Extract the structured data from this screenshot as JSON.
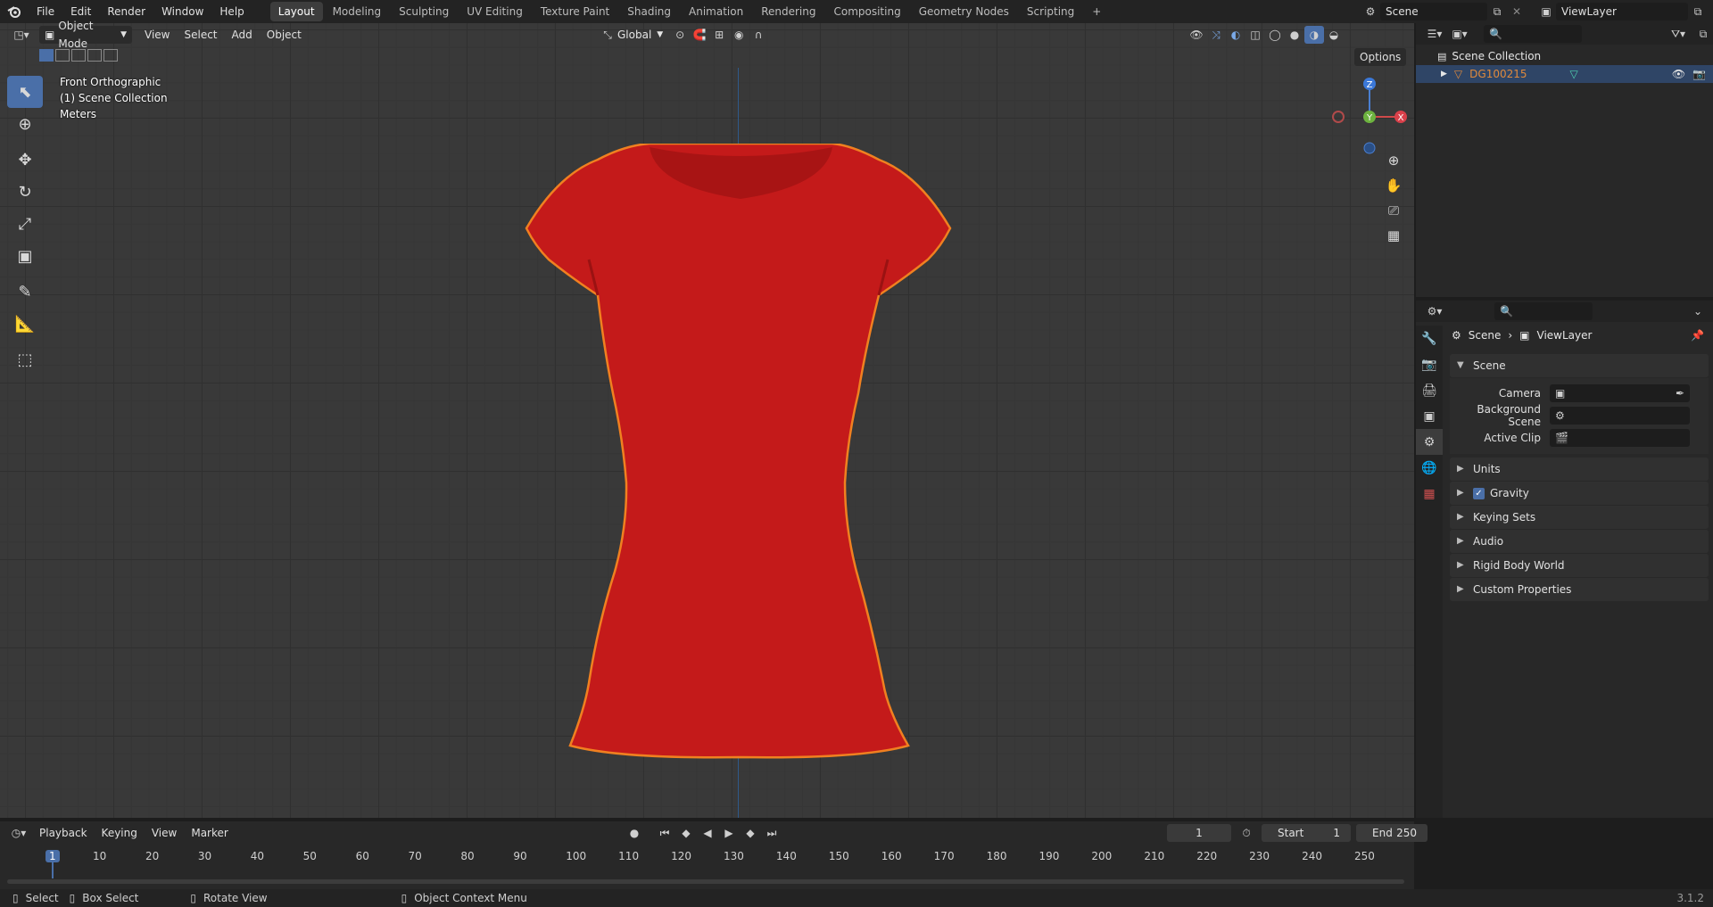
{
  "topbar": {
    "menus": [
      "File",
      "Edit",
      "Render",
      "Window",
      "Help"
    ],
    "workspaces": [
      "Layout",
      "Modeling",
      "Sculpting",
      "UV Editing",
      "Texture Paint",
      "Shading",
      "Animation",
      "Rendering",
      "Compositing",
      "Geometry Nodes",
      "Scripting"
    ],
    "active_workspace": "Layout",
    "add_tab": "+",
    "scene": "Scene",
    "view_layer": "ViewLayer"
  },
  "viewport": {
    "mode": "Object Mode",
    "menus": [
      "View",
      "Select",
      "Add",
      "Object"
    ],
    "transform_orientation": "Global",
    "options_label": "Options",
    "overlay_lines": [
      "Front Orthographic",
      "(1) Scene Collection",
      "Meters"
    ],
    "gizmo": {
      "z": "Z",
      "y": "Y",
      "x": "X"
    },
    "object_color": "#c41a1a",
    "outline_color": "#f08020"
  },
  "outliner": {
    "root": "Scene Collection",
    "object": "DG100215"
  },
  "properties": {
    "breadcrumb_scene": "Scene",
    "breadcrumb_layer": "ViewLayer",
    "panel_title": "Scene",
    "fields": [
      {
        "label": "Camera",
        "value": ""
      },
      {
        "label": "Background Scene",
        "value": ""
      },
      {
        "label": "Active Clip",
        "value": ""
      }
    ],
    "subpanels": [
      "Units",
      "Gravity",
      "Keying Sets",
      "Audio",
      "Rigid Body World",
      "Custom Properties"
    ],
    "gravity_checked": true
  },
  "timeline": {
    "menus": [
      "Playback",
      "Keying",
      "View",
      "Marker"
    ],
    "current_frame": "1",
    "start_label": "Start",
    "start": "1",
    "end_label": "End",
    "end": "250",
    "ticks": [
      "1",
      "10",
      "20",
      "30",
      "40",
      "50",
      "60",
      "70",
      "80",
      "90",
      "100",
      "110",
      "120",
      "130",
      "140",
      "150",
      "160",
      "170",
      "180",
      "190",
      "200",
      "210",
      "220",
      "230",
      "240",
      "250"
    ]
  },
  "statusbar": {
    "select": "Select",
    "box_select": "Box Select",
    "rotate_view": "Rotate View",
    "context_menu": "Object Context Menu",
    "version": "3.1.2"
  }
}
